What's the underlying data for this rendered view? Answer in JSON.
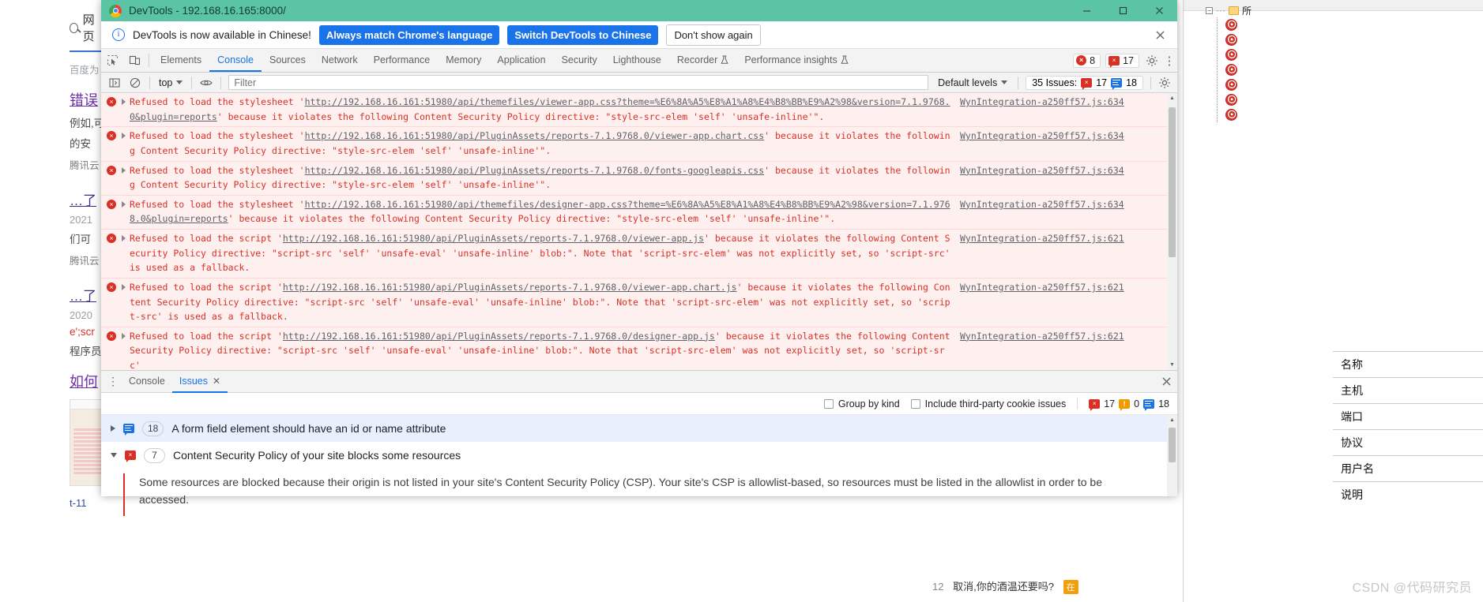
{
  "background": {
    "search_query": "网页",
    "source_label": "百度为",
    "result1": {
      "title": "错误",
      "line1": "例如,可",
      "line2": "的安",
      "source": "腾讯云"
    },
    "result2": {
      "title": "…了",
      "date": "2021",
      "line1": "们可",
      "source": "腾讯云"
    },
    "result3": {
      "title": "…了",
      "date": "2020",
      "code": "e';scr",
      "line1": "程序员"
    },
    "result4": {
      "title": "如何"
    },
    "bottom_link": "t-11",
    "right_panel": {
      "tree_root": "所",
      "fields": [
        "名称",
        "主机",
        "端口",
        "协议",
        "用户名",
        "说明"
      ],
      "watermark": "CSDN @代码研究员"
    },
    "status_line": {
      "number": "12",
      "text": "取消,你的酒温还要吗?",
      "badge": "在"
    }
  },
  "devtools": {
    "window": {
      "title": "DevTools - 192.168.16.165:8000/",
      "minimize": "minimize",
      "maximize": "maximize",
      "close": "close"
    },
    "banner": {
      "message": "DevTools is now available in Chinese!",
      "primary_button": "Always match Chrome's language",
      "secondary_button": "Switch DevTools to Chinese",
      "dismiss_button": "Don't show again",
      "close": "×"
    },
    "tabs": [
      {
        "label": "Elements",
        "active": false,
        "experimental": false
      },
      {
        "label": "Console",
        "active": true,
        "experimental": false
      },
      {
        "label": "Sources",
        "active": false,
        "experimental": false
      },
      {
        "label": "Network",
        "active": false,
        "experimental": false
      },
      {
        "label": "Performance",
        "active": false,
        "experimental": false
      },
      {
        "label": "Memory",
        "active": false,
        "experimental": false
      },
      {
        "label": "Application",
        "active": false,
        "experimental": false
      },
      {
        "label": "Security",
        "active": false,
        "experimental": false
      },
      {
        "label": "Lighthouse",
        "active": false,
        "experimental": false
      },
      {
        "label": "Recorder",
        "active": false,
        "experimental": true
      },
      {
        "label": "Performance insights",
        "active": false,
        "experimental": true
      }
    ],
    "counters": {
      "errors": "8",
      "warnings": "17"
    },
    "console_toolbar": {
      "context": "top",
      "filter_placeholder": "Filter",
      "filter_value": "",
      "levels": "Default levels",
      "issues_label": "35 Issues:",
      "issues_errors": "17",
      "issues_info": "18"
    },
    "messages": [
      {
        "pre": "Refused to load the stylesheet '",
        "url": "http://192.168.16.161:51980/api/themefiles/viewer-app.css?theme=%E6%8A%A5%E8%A1%A8%E4%B8%BB%E9%A2%98&version=7.1.9768.0&plugin=reports",
        "post": "' because it violates the following Content Security Policy directive: \"style-src-elem 'self' 'unsafe-inline'\".",
        "source": "WynIntegration-a250ff57.js:634"
      },
      {
        "pre": "Refused to load the stylesheet '",
        "url": "http://192.168.16.161:51980/api/PluginAssets/reports-7.1.9768.0/viewer-app.chart.css",
        "post": "' because it violates the following Content Security Policy directive: \"style-src-elem 'self' 'unsafe-inline'\".",
        "source": "WynIntegration-a250ff57.js:634"
      },
      {
        "pre": "Refused to load the stylesheet '",
        "url": "http://192.168.16.161:51980/api/PluginAssets/reports-7.1.9768.0/fonts-googleapis.css",
        "post": "' because it violates the following Content Security Policy directive: \"style-src-elem 'self' 'unsafe-inline'\".",
        "source": "WynIntegration-a250ff57.js:634"
      },
      {
        "pre": "Refused to load the stylesheet '",
        "url": "http://192.168.16.161:51980/api/themefiles/designer-app.css?theme=%E6%8A%A5%E8%A1%A8%E4%B8%BB%E9%A2%98&version=7.1.9768.0&plugin=reports",
        "post": "' because it violates the following Content Security Policy directive: \"style-src-elem 'self' 'unsafe-inline'\".",
        "source": "WynIntegration-a250ff57.js:634"
      },
      {
        "pre": "Refused to load the script '",
        "url": "http://192.168.16.161:51980/api/PluginAssets/reports-7.1.9768.0/viewer-app.js",
        "post": "' because it violates the following Content Security Policy directive: \"script-src 'self' 'unsafe-eval' 'unsafe-inline' blob:\". Note that 'script-src-elem' was not explicitly set, so 'script-src' is used as a fallback.",
        "source": "WynIntegration-a250ff57.js:621"
      },
      {
        "pre": "Refused to load the script '",
        "url": "http://192.168.16.161:51980/api/PluginAssets/reports-7.1.9768.0/viewer-app.chart.js",
        "post": "' because it violates the following Content Security Policy directive: \"script-src 'self' 'unsafe-eval' 'unsafe-inline' blob:\". Note that 'script-src-elem' was not explicitly set, so 'script-src' is used as a fallback.",
        "source": "WynIntegration-a250ff57.js:621"
      },
      {
        "pre": "Refused to load the script '",
        "url": "http://192.168.16.161:51980/api/PluginAssets/reports-7.1.9768.0/designer-app.js",
        "post": "' because it violates the following Content Security Policy directive: \"script-src 'self' 'unsafe-eval' 'unsafe-inline' blob:\". Note that 'script-src-elem' was not explicitly set, so 'script-src'",
        "source": "WynIntegration-a250ff57.js:621"
      }
    ],
    "drawer": {
      "tabs": [
        {
          "label": "Console",
          "active": false
        },
        {
          "label": "Issues",
          "active": true
        }
      ],
      "close": "×",
      "group_by_kind": "Group by kind",
      "include_third_party": "Include third-party cookie issues",
      "summary": {
        "errors": "17",
        "warnings": "0",
        "info": "18"
      },
      "issues": [
        {
          "count": "18",
          "title": "A form field element should have an id or name attribute",
          "kind": "info",
          "expanded": false
        },
        {
          "count": "7",
          "title": "Content Security Policy of your site blocks some resources",
          "kind": "error",
          "expanded": true,
          "description": "Some resources are blocked because their origin is not listed in your site's Content Security Policy (CSP). Your site's CSP is allowlist-based, so resources must be listed in the allowlist in order to be accessed."
        }
      ]
    }
  },
  "colors": {
    "titlebar": "#5bc4a5",
    "accent_blue": "#1a73e8",
    "error_red": "#d93025",
    "error_bg": "#fff0f0",
    "warning_orange": "#f29900"
  }
}
